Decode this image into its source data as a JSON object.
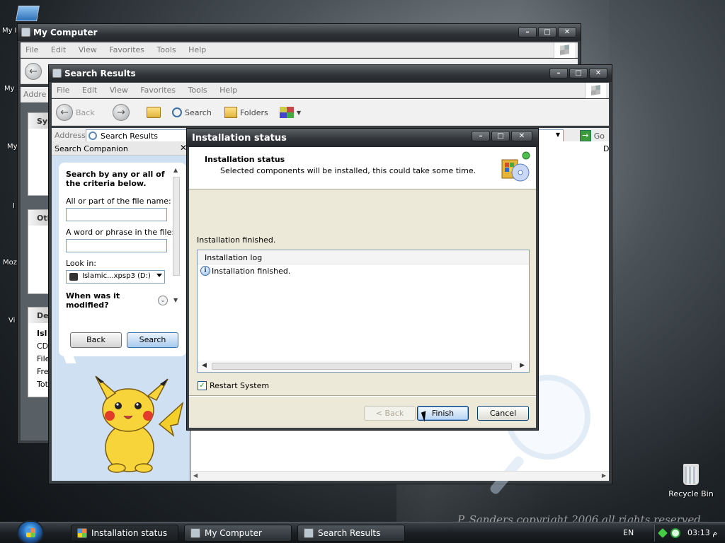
{
  "desktop": {
    "icons": [
      {
        "label": "My I"
      },
      {
        "label": "My"
      },
      {
        "label": "My"
      },
      {
        "label": "I"
      },
      {
        "label": "Moz"
      },
      {
        "label": "Vi"
      }
    ],
    "recycle_bin": "Recycle Bin",
    "watermark": "P. Sanders copyright 2006 all rights reserved"
  },
  "my_computer": {
    "title": "My Computer",
    "menu": [
      "File",
      "Edit",
      "View",
      "Favorites",
      "Tools",
      "Help"
    ],
    "address_label": "Addre",
    "task_groups": [
      "Sys",
      "Oth",
      "De"
    ],
    "details": [
      "Isl",
      "CD",
      "File",
      "Fre",
      "Tot"
    ]
  },
  "search_results": {
    "title": "Search Results",
    "menu": [
      "File",
      "Edit",
      "View",
      "Favorites",
      "Tools",
      "Help"
    ],
    "toolbar": {
      "back": "Back",
      "search": "Search",
      "folders": "Folders"
    },
    "address_label": "Address",
    "address_value": "Search Results",
    "go": "Go",
    "column_stub": "D",
    "companion": {
      "header": "Search Companion",
      "close": "✕",
      "heading": "Search by any or all of the criteria below.",
      "filename_label": "All or part of the file name:",
      "filename_value": "",
      "phrase_label": "A word or phrase in the file:",
      "phrase_value": "",
      "lookin_label": "Look in:",
      "lookin_value": "Islamic...xpsp3 (D:)",
      "modified_label": "When was it modified?",
      "back_button": "Back",
      "search_button": "Search"
    }
  },
  "dialog": {
    "title": "Installation status",
    "header_title": "Installation status",
    "header_subtitle": "Selected components will be installed, this could take some time.",
    "status": "Installation finished.",
    "log_header": "Installation log",
    "log_entries": [
      "Installation finished."
    ],
    "restart_label": "Restart System",
    "restart_checked": true,
    "back_button": "< Back",
    "finish_button": "Finish",
    "cancel_button": "Cancel"
  },
  "taskbar": {
    "items": [
      {
        "label": "Installation status",
        "active": true
      },
      {
        "label": "My Computer",
        "active": false
      },
      {
        "label": "Search Results",
        "active": false
      }
    ],
    "language": "EN",
    "clock": "03:13 م"
  }
}
